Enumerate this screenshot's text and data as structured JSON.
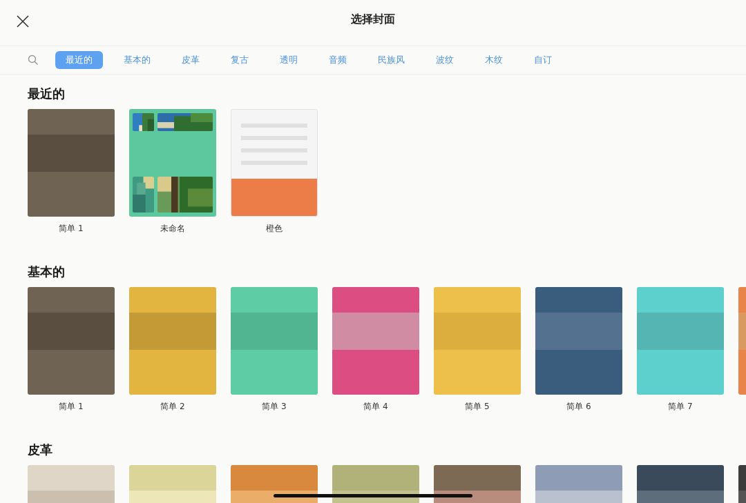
{
  "header": {
    "title": "选择封面"
  },
  "tabs": [
    {
      "label": "最近的",
      "selected": true
    },
    {
      "label": "基本的",
      "selected": false
    },
    {
      "label": "皮革",
      "selected": false
    },
    {
      "label": "复古",
      "selected": false
    },
    {
      "label": "透明",
      "selected": false
    },
    {
      "label": "音频",
      "selected": false
    },
    {
      "label": "民族风",
      "selected": false
    },
    {
      "label": "波纹",
      "selected": false
    },
    {
      "label": "木纹",
      "selected": false
    },
    {
      "label": "自订",
      "selected": false
    }
  ],
  "sections": [
    {
      "heading": "最近的",
      "covers": [
        {
          "kind": "band",
          "color": "#6f6353",
          "band": {
            "color": "#5a4e41"
          },
          "label": "简单 1"
        },
        {
          "color": "#5dc79e",
          "label": "未命名"
        },
        {
          "kind": "lines",
          "color": "#ec7c48",
          "label": "橙色"
        }
      ]
    },
    {
      "heading": "基本的",
      "covers": [
        {
          "kind": "band",
          "color": "#6f6353",
          "band": {
            "color": "#5a4e41"
          },
          "label": "简单 1"
        },
        {
          "kind": "band",
          "color": "#e2b440",
          "band": {
            "color": "#c39a35"
          },
          "label": "简单 2"
        },
        {
          "kind": "band",
          "color": "#5ecda5",
          "band": {
            "color": "#52b592"
          },
          "label": "简单 3"
        },
        {
          "kind": "band",
          "color": "#dc4d82",
          "band": {
            "color": "#cf8ca2"
          },
          "label": "简单 4"
        },
        {
          "kind": "band",
          "color": "#ecc04a",
          "band": {
            "color": "#dcae3e"
          },
          "label": "简单 5"
        },
        {
          "kind": "band",
          "color": "#3a5d7d",
          "band": {
            "color": "#54728f"
          },
          "label": "简单 6"
        },
        {
          "kind": "band",
          "color": "#5dd0cd",
          "band": {
            "color": "#55b5b3"
          },
          "label": "简单 7"
        },
        {
          "kind": "band",
          "color": "#e8834a",
          "band": {
            "color": "#d99a62"
          }
        }
      ]
    },
    {
      "heading": "皮革",
      "covers": [
        {
          "kind": "band",
          "color": "#e0d6c8",
          "band": {
            "color": "#cbbfb0"
          }
        },
        {
          "kind": "band",
          "color": "#dcd59a",
          "band": {
            "color": "#ece6b8"
          }
        },
        {
          "kind": "band",
          "color": "#d8893e",
          "band": {
            "color": "#eaad6a"
          }
        },
        {
          "kind": "band",
          "color": "#b0b27a",
          "band": {
            "color": "#c1c28e"
          }
        },
        {
          "kind": "band",
          "color": "#7d6a55",
          "band": {
            "color": "#b98d7d"
          }
        },
        {
          "kind": "band",
          "color": "#8e9cb5",
          "band": {
            "color": "#b9c1cf"
          }
        },
        {
          "kind": "band",
          "color": "#3a4a5a",
          "band": {
            "color": "#5d6d7c"
          }
        },
        {
          "kind": "band",
          "color": "#3c3c3c",
          "band": {
            "color": "#555555"
          }
        }
      ]
    }
  ]
}
